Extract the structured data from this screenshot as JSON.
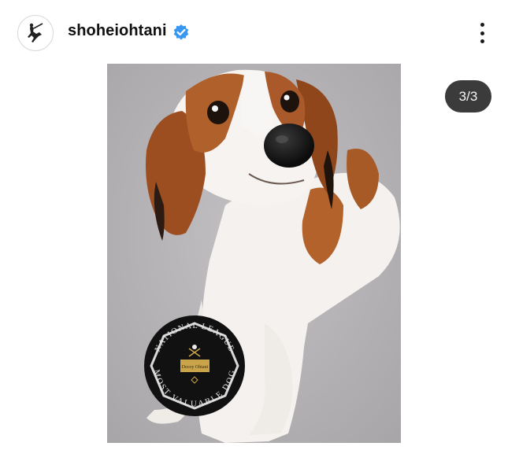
{
  "post": {
    "username": "shoheiohtani",
    "verified": true,
    "avatar_icon": "batter-silhouette-icon",
    "more_icon": "more-vertical-icon"
  },
  "carousel": {
    "current": 3,
    "total": 3,
    "counter_text": "3/3"
  },
  "photo": {
    "badge": {
      "top_text": "NATIONAL LEAGUE",
      "bottom_text": "MOST VALUABLE DOG",
      "plaque_text": "Decoy Ohtani"
    }
  },
  "colors": {
    "verified_blue": "#3897f0",
    "counter_bg": "#3b3b3b"
  }
}
